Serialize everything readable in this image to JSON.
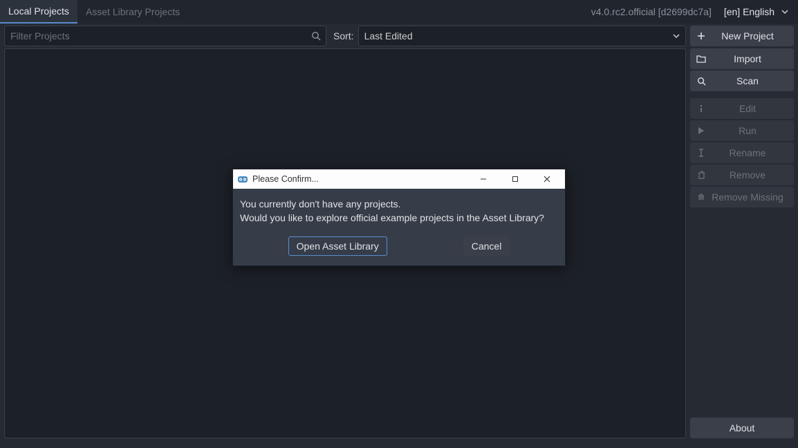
{
  "topbar": {
    "tabs": {
      "local": "Local Projects",
      "asset": "Asset Library Projects"
    },
    "version": "v4.0.rc2.official [d2699dc7a]",
    "language": "[en] English"
  },
  "toolbar": {
    "filter_placeholder": "Filter Projects",
    "sort_label": "Sort:",
    "sort_value": "Last Edited"
  },
  "side": {
    "new_project": "New Project",
    "import": "Import",
    "scan": "Scan",
    "edit": "Edit",
    "run": "Run",
    "rename": "Rename",
    "remove": "Remove",
    "remove_missing": "Remove Missing",
    "about": "About"
  },
  "dialog": {
    "title": "Please Confirm...",
    "line1": "You currently don't have any projects.",
    "line2": "Would you like to explore official example projects in the Asset Library?",
    "open": "Open Asset Library",
    "cancel": "Cancel"
  }
}
